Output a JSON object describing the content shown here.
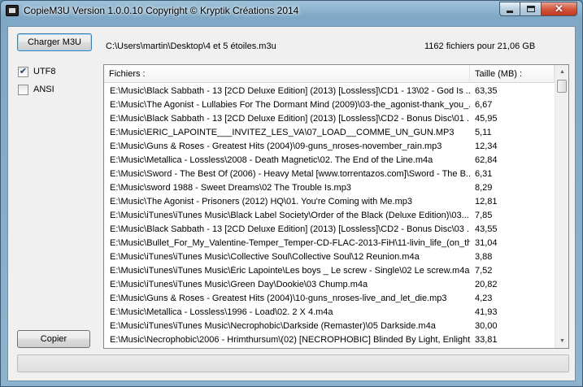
{
  "window": {
    "title": "CopieM3U Version 1.0.0.10  Copyright © Kryptik Créations 2014",
    "close_glyph": "✕"
  },
  "toolbar": {
    "load_label": "Charger M3U",
    "copy_label": "Copier",
    "path": "C:\\Users\\martin\\Desktop\\4 et 5 étoiles.m3u",
    "summary": "1162 fichiers pour 21,06 GB"
  },
  "options": {
    "utf8": {
      "label": "UTF8",
      "checked": true,
      "mark": "✔"
    },
    "ansi": {
      "label": "ANSI",
      "checked": false
    }
  },
  "list": {
    "headers": {
      "file": "Fichiers :",
      "size": "Taille (MB) :"
    },
    "rows": [
      {
        "file": "E:\\Music\\Black Sabbath - 13 [2CD Deluxe Edition] (2013) [Lossless]\\CD1 - 13\\02 - God Is ...",
        "size": "63,35"
      },
      {
        "file": "E:\\Music\\The Agonist - Lullabies For The Dormant Mind (2009)\\03-the_agonist-thank_you_...",
        "size": "6,67"
      },
      {
        "file": "E:\\Music\\Black Sabbath - 13 [2CD Deluxe Edition] (2013) [Lossless]\\CD2 - Bonus Disc\\01 ...",
        "size": "45,95"
      },
      {
        "file": "E:\\Music\\ERIC_LAPOINTE___INVITEZ_LES_VA\\07_LOAD__COMME_UN_GUN.MP3",
        "size": "5,11"
      },
      {
        "file": "E:\\Music\\Guns & Roses - Greatest Hits (2004)\\09-guns_nroses-november_rain.mp3",
        "size": "12,34"
      },
      {
        "file": "E:\\Music\\Metallica - Lossless\\2008 - Death Magnetic\\02. The End of the Line.m4a",
        "size": "62,84"
      },
      {
        "file": "E:\\Music\\Sword - The Best Of (2006) - Heavy Metal [www.torrentazos.com]\\Sword - The B...",
        "size": "6,31"
      },
      {
        "file": "E:\\Music\\sword 1988 - Sweet Dreams\\02 The Trouble Is.mp3",
        "size": "8,29"
      },
      {
        "file": "E:\\Music\\The Agonist - Prisoners (2012) HQ\\01. You're Coming with Me.mp3",
        "size": "12,81"
      },
      {
        "file": "E:\\Music\\iTunes\\iTunes Music\\Black Label Society\\Order of the Black (Deluxe Edition)\\03...",
        "size": "7,85"
      },
      {
        "file": "E:\\Music\\Black Sabbath - 13 [2CD Deluxe Edition] (2013) [Lossless]\\CD2 - Bonus Disc\\03 ...",
        "size": "43,55"
      },
      {
        "file": "E:\\Music\\Bullet_For_My_Valentine-Temper_Temper-CD-FLAC-2013-FiH\\11-livin_life_(on_th...",
        "size": "31,04"
      },
      {
        "file": "E:\\Music\\iTunes\\iTunes Music\\Collective Soul\\Collective Soul\\12 Reunion.m4a",
        "size": "3,88"
      },
      {
        "file": "E:\\Music\\iTunes\\iTunes Music\\Éric Lapointe\\Les boys _ Le screw - Single\\02 Le screw.m4a",
        "size": "7,52"
      },
      {
        "file": "E:\\Music\\iTunes\\iTunes Music\\Green Day\\Dookie\\03 Chump.m4a",
        "size": "20,82"
      },
      {
        "file": "E:\\Music\\Guns & Roses - Greatest Hits (2004)\\10-guns_nroses-live_and_let_die.mp3",
        "size": "4,23"
      },
      {
        "file": "E:\\Music\\Metallica - Lossless\\1996 - Load\\02. 2 X 4.m4a",
        "size": "41,93"
      },
      {
        "file": "E:\\Music\\iTunes\\iTunes Music\\Necrophobic\\Darkside (Remaster)\\05 Darkside.m4a",
        "size": "30,00"
      },
      {
        "file": "E:\\Music\\Necrophobic\\2006 - Hrimthursum\\(02) [NECROPHOBIC] Blinded By Light, Enlight...",
        "size": "33,81"
      }
    ]
  },
  "scrollbar": {
    "up_glyph": "▲",
    "down_glyph": "▼"
  },
  "progress": {
    "value": 0.0
  },
  "colors": {
    "progress_fill": "#37c022",
    "default_button_border": "#3c7fb1"
  }
}
